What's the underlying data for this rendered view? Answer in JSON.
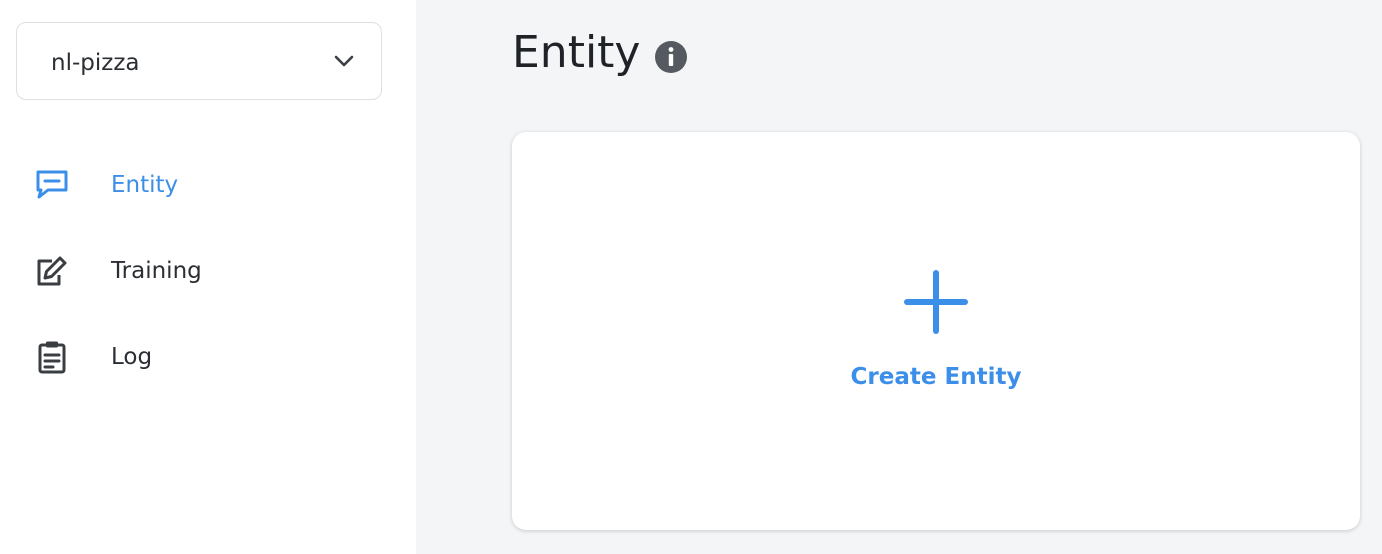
{
  "project": {
    "name": "nl-pizza",
    "dropdown_icon": "chevron-down-icon"
  },
  "sidebar": {
    "items": [
      {
        "label": "Entity",
        "icon": "message-square-icon",
        "active": true
      },
      {
        "label": "Training",
        "icon": "pen-square-icon",
        "active": false
      },
      {
        "label": "Log",
        "icon": "clipboard-icon",
        "active": false
      }
    ]
  },
  "main": {
    "title": "Entity",
    "title_icon": "info-icon",
    "card": {
      "action_label": "Create Entity",
      "action_icon": "plus-icon"
    }
  },
  "colors": {
    "accent": "#3c8fe8",
    "text": "#2b2f33",
    "background": "#f4f5f7",
    "sidebar_bg": "#ffffff",
    "muted_icon": "#555a60"
  }
}
